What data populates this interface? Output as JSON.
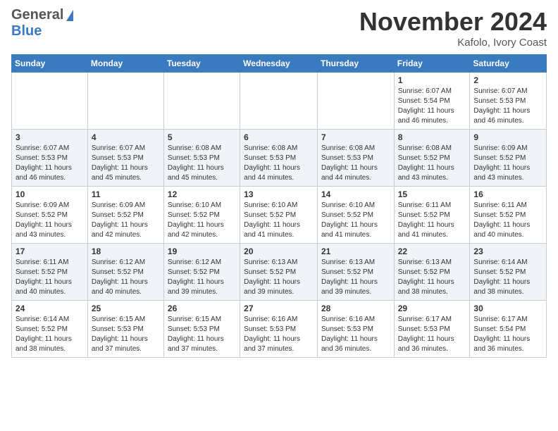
{
  "header": {
    "logo_general": "General",
    "logo_blue": "Blue",
    "month_title": "November 2024",
    "subtitle": "Kafolo, Ivory Coast"
  },
  "weekdays": [
    "Sunday",
    "Monday",
    "Tuesday",
    "Wednesday",
    "Thursday",
    "Friday",
    "Saturday"
  ],
  "weeks": [
    [
      {
        "day": "",
        "info": ""
      },
      {
        "day": "",
        "info": ""
      },
      {
        "day": "",
        "info": ""
      },
      {
        "day": "",
        "info": ""
      },
      {
        "day": "",
        "info": ""
      },
      {
        "day": "1",
        "info": "Sunrise: 6:07 AM\nSunset: 5:54 PM\nDaylight: 11 hours\nand 46 minutes."
      },
      {
        "day": "2",
        "info": "Sunrise: 6:07 AM\nSunset: 5:53 PM\nDaylight: 11 hours\nand 46 minutes."
      }
    ],
    [
      {
        "day": "3",
        "info": "Sunrise: 6:07 AM\nSunset: 5:53 PM\nDaylight: 11 hours\nand 46 minutes."
      },
      {
        "day": "4",
        "info": "Sunrise: 6:07 AM\nSunset: 5:53 PM\nDaylight: 11 hours\nand 45 minutes."
      },
      {
        "day": "5",
        "info": "Sunrise: 6:08 AM\nSunset: 5:53 PM\nDaylight: 11 hours\nand 45 minutes."
      },
      {
        "day": "6",
        "info": "Sunrise: 6:08 AM\nSunset: 5:53 PM\nDaylight: 11 hours\nand 44 minutes."
      },
      {
        "day": "7",
        "info": "Sunrise: 6:08 AM\nSunset: 5:53 PM\nDaylight: 11 hours\nand 44 minutes."
      },
      {
        "day": "8",
        "info": "Sunrise: 6:08 AM\nSunset: 5:52 PM\nDaylight: 11 hours\nand 43 minutes."
      },
      {
        "day": "9",
        "info": "Sunrise: 6:09 AM\nSunset: 5:52 PM\nDaylight: 11 hours\nand 43 minutes."
      }
    ],
    [
      {
        "day": "10",
        "info": "Sunrise: 6:09 AM\nSunset: 5:52 PM\nDaylight: 11 hours\nand 43 minutes."
      },
      {
        "day": "11",
        "info": "Sunrise: 6:09 AM\nSunset: 5:52 PM\nDaylight: 11 hours\nand 42 minutes."
      },
      {
        "day": "12",
        "info": "Sunrise: 6:10 AM\nSunset: 5:52 PM\nDaylight: 11 hours\nand 42 minutes."
      },
      {
        "day": "13",
        "info": "Sunrise: 6:10 AM\nSunset: 5:52 PM\nDaylight: 11 hours\nand 41 minutes."
      },
      {
        "day": "14",
        "info": "Sunrise: 6:10 AM\nSunset: 5:52 PM\nDaylight: 11 hours\nand 41 minutes."
      },
      {
        "day": "15",
        "info": "Sunrise: 6:11 AM\nSunset: 5:52 PM\nDaylight: 11 hours\nand 41 minutes."
      },
      {
        "day": "16",
        "info": "Sunrise: 6:11 AM\nSunset: 5:52 PM\nDaylight: 11 hours\nand 40 minutes."
      }
    ],
    [
      {
        "day": "17",
        "info": "Sunrise: 6:11 AM\nSunset: 5:52 PM\nDaylight: 11 hours\nand 40 minutes."
      },
      {
        "day": "18",
        "info": "Sunrise: 6:12 AM\nSunset: 5:52 PM\nDaylight: 11 hours\nand 40 minutes."
      },
      {
        "day": "19",
        "info": "Sunrise: 6:12 AM\nSunset: 5:52 PM\nDaylight: 11 hours\nand 39 minutes."
      },
      {
        "day": "20",
        "info": "Sunrise: 6:13 AM\nSunset: 5:52 PM\nDaylight: 11 hours\nand 39 minutes."
      },
      {
        "day": "21",
        "info": "Sunrise: 6:13 AM\nSunset: 5:52 PM\nDaylight: 11 hours\nand 39 minutes."
      },
      {
        "day": "22",
        "info": "Sunrise: 6:13 AM\nSunset: 5:52 PM\nDaylight: 11 hours\nand 38 minutes."
      },
      {
        "day": "23",
        "info": "Sunrise: 6:14 AM\nSunset: 5:52 PM\nDaylight: 11 hours\nand 38 minutes."
      }
    ],
    [
      {
        "day": "24",
        "info": "Sunrise: 6:14 AM\nSunset: 5:52 PM\nDaylight: 11 hours\nand 38 minutes."
      },
      {
        "day": "25",
        "info": "Sunrise: 6:15 AM\nSunset: 5:53 PM\nDaylight: 11 hours\nand 37 minutes."
      },
      {
        "day": "26",
        "info": "Sunrise: 6:15 AM\nSunset: 5:53 PM\nDaylight: 11 hours\nand 37 minutes."
      },
      {
        "day": "27",
        "info": "Sunrise: 6:16 AM\nSunset: 5:53 PM\nDaylight: 11 hours\nand 37 minutes."
      },
      {
        "day": "28",
        "info": "Sunrise: 6:16 AM\nSunset: 5:53 PM\nDaylight: 11 hours\nand 36 minutes."
      },
      {
        "day": "29",
        "info": "Sunrise: 6:17 AM\nSunset: 5:53 PM\nDaylight: 11 hours\nand 36 minutes."
      },
      {
        "day": "30",
        "info": "Sunrise: 6:17 AM\nSunset: 5:54 PM\nDaylight: 11 hours\nand 36 minutes."
      }
    ]
  ]
}
